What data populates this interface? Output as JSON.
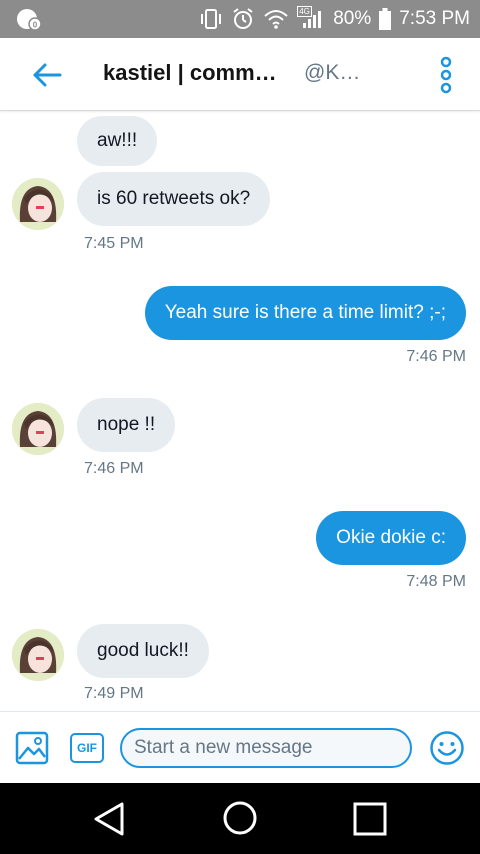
{
  "status_bar": {
    "battery": "80%",
    "time": "7:53 PM",
    "network": "4G"
  },
  "header": {
    "title": "kastiel | comm…",
    "handle": "@K…"
  },
  "messages": [
    {
      "direction": "incoming",
      "text": "aw!!!"
    },
    {
      "direction": "incoming",
      "text": "is 60 retweets ok?",
      "time": "7:45 PM"
    },
    {
      "direction": "outgoing",
      "text": "Yeah sure is there a time limit?  ;-;",
      "time": "7:46 PM"
    },
    {
      "direction": "incoming",
      "text": "nope !!",
      "time": "7:46 PM"
    },
    {
      "direction": "outgoing",
      "text": "Okie dokie c:",
      "time": "7:48 PM"
    },
    {
      "direction": "incoming",
      "text": "good luck!!",
      "time": "7:49 PM"
    }
  ],
  "composer": {
    "placeholder": "Start a new message",
    "gif_label": "GIF"
  },
  "colors": {
    "accent": "#1b95e0",
    "incoming_bubble": "#e6ecf0",
    "status_bar": "#8c8c8c",
    "nav_bar": "#000000"
  },
  "icons": {
    "back": "arrow-left-icon",
    "more": "more-vertical-icon",
    "image": "image-icon",
    "emoji": "emoji-icon",
    "nav_back": "nav-back-icon",
    "nav_home": "nav-home-icon",
    "nav_recents": "nav-recents-icon"
  }
}
